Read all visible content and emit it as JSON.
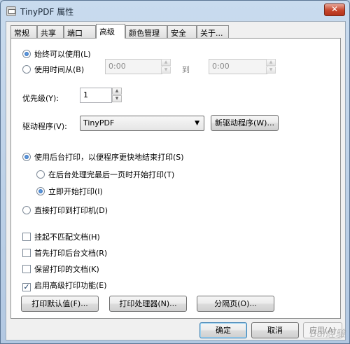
{
  "window": {
    "title": "TinyPDF 属性",
    "close_glyph": "✕"
  },
  "tabs": [
    {
      "label": "常规"
    },
    {
      "label": "共享"
    },
    {
      "label": "端口"
    },
    {
      "label": "高级",
      "active": true
    },
    {
      "label": "颜色管理"
    },
    {
      "label": "安全"
    },
    {
      "label": "关于..."
    }
  ],
  "availability": {
    "always_label": "始终可以使用(L)",
    "always_selected": true,
    "from_label": "使用时间从(B)",
    "from_value": "0:00",
    "to_label": "到",
    "to_value": "0:00"
  },
  "priority": {
    "label": "优先级(Y):",
    "value": "1"
  },
  "driver": {
    "label": "驱动程序(V):",
    "selected": "TinyPDF",
    "new_driver_label": "新驱动程序(W)..."
  },
  "spool": {
    "spool_label": "使用后台打印，以便程序更快地结束打印(S)",
    "spool_selected": true,
    "after_last_page_label": "在后台处理完最后一页时开始打印(T)",
    "immediately_label": "立即开始打印(I)",
    "immediately_selected": true,
    "direct_label": "直接打印到打印机(D)"
  },
  "options": [
    {
      "label": "挂起不匹配文档(H)",
      "checked": false
    },
    {
      "label": "首先打印后台文档(R)",
      "checked": false
    },
    {
      "label": "保留打印的文档(K)",
      "checked": false
    },
    {
      "label": "启用高级打印功能(E)",
      "checked": true
    }
  ],
  "action_buttons": {
    "defaults_label": "打印默认值(F)...",
    "processor_label": "打印处理器(N)...",
    "separator_page_label": "分隔页(O)..."
  },
  "footer": {
    "ok_label": "确定",
    "cancel_label": "取消",
    "apply_label": "应用(A)"
  },
  "watermark": "Bai經驗"
}
